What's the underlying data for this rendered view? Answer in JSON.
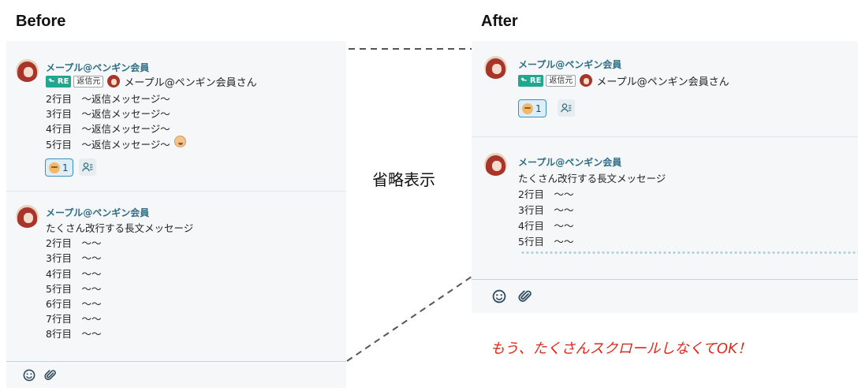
{
  "headings": {
    "before": "Before",
    "after": "After"
  },
  "middle_label": "省略表示",
  "caption": "もう、たくさんスクロールしなくてOK！",
  "user_name": "メープル@ペンギン会員",
  "reply": {
    "re_label": "RE",
    "source_label": "返信元",
    "target_name": "メープル@ペンギン会員さん"
  },
  "before": {
    "message1_lines": [
      "2行目　〜返信メッセージ〜",
      "3行目　〜返信メッセージ〜",
      "4行目　〜返信メッセージ〜",
      "5行目　〜返信メッセージ〜"
    ],
    "reaction_count": "1",
    "message2_lines": [
      "たくさん改行する長文メッセージ",
      "2行目　〜〜",
      "3行目　〜〜",
      "4行目　〜〜",
      "5行目　〜〜",
      "6行目　〜〜",
      "7行目　〜〜",
      "8行目　〜〜"
    ]
  },
  "after": {
    "reaction_count": "1",
    "message2_lines": [
      "たくさん改行する長文メッセージ",
      "2行目　〜〜",
      "3行目　〜〜",
      "4行目　〜〜",
      "5行目　〜〜"
    ]
  },
  "icons": [
    "avatar",
    "reply-arrow-icon",
    "smile-emoji-icon",
    "reaction-users-icon",
    "emoji-picker-icon",
    "attachment-icon"
  ],
  "colors": {
    "username": "#2f6e84",
    "re_tag": "#1fa88f",
    "caption": "#e0261a",
    "reaction_border": "#3d8fc0"
  }
}
